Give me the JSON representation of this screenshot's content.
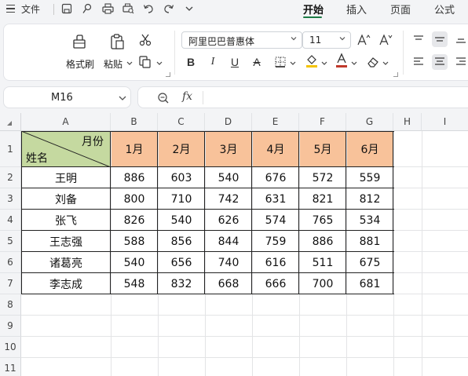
{
  "menu": {
    "file_label": "文件",
    "tabs": [
      {
        "label": "开始",
        "active": true
      },
      {
        "label": "插入",
        "active": false
      },
      {
        "label": "页面",
        "active": false
      },
      {
        "label": "公式",
        "active": false
      }
    ],
    "quick_access_icons": [
      "save-icon",
      "format-painter-icon",
      "print-icon",
      "print-preview-icon",
      "undo-icon",
      "redo-icon",
      "chevron-down-icon"
    ]
  },
  "ribbon": {
    "format_painter_label": "格式刷",
    "paste_label": "粘贴",
    "font_name": "阿里巴巴普惠体",
    "font_size": "11",
    "accent_color": "#1b7b45",
    "font_color_bar": "#c0392b",
    "fill_color_bar": "#f4c300"
  },
  "formula_bar": {
    "cell_reference": "M16",
    "fx_label": "fx",
    "content": ""
  },
  "sheet": {
    "columns": [
      "A",
      "B",
      "C",
      "D",
      "E",
      "F",
      "G",
      "H",
      "I"
    ],
    "rows": [
      "1",
      "2",
      "3",
      "4",
      "5",
      "6",
      "7",
      "8",
      "9",
      "10",
      "11"
    ],
    "header_top_right": "月份",
    "header_bottom_left": "姓名",
    "months": [
      "1月",
      "2月",
      "3月",
      "4月",
      "5月",
      "6月"
    ],
    "header_fill_color": "#f8c29a",
    "corner_fill_color": "#c5d9a0",
    "names": [
      "王明",
      "刘备",
      "张飞",
      "王志强",
      "诸葛亮",
      "李志成"
    ],
    "values": [
      [
        "886",
        "603",
        "540",
        "676",
        "572",
        "559"
      ],
      [
        "800",
        "710",
        "742",
        "631",
        "821",
        "812"
      ],
      [
        "826",
        "540",
        "626",
        "574",
        "765",
        "534"
      ],
      [
        "588",
        "856",
        "844",
        "759",
        "886",
        "881"
      ],
      [
        "540",
        "656",
        "740",
        "616",
        "511",
        "675"
      ],
      [
        "548",
        "832",
        "668",
        "666",
        "700",
        "681"
      ]
    ]
  }
}
